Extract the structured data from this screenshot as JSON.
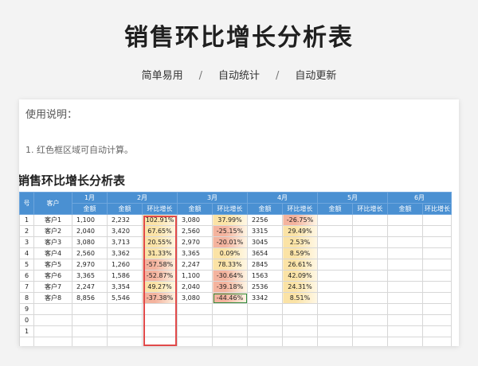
{
  "header": {
    "title": "销售环比增长分析表",
    "features": [
      "简单易用",
      "自动统计",
      "自动更新"
    ],
    "separator": "/"
  },
  "sheet": {
    "usage_label": "使用说明：",
    "note": "1. 红色框区域可自动计算。",
    "title": "销售环比增长分析表",
    "index_header": "号",
    "customer_header": "客户",
    "months": [
      "1月",
      "2月",
      "3月",
      "4月",
      "5月",
      "6月"
    ],
    "sub_amount": "金额",
    "sub_growth": "环比增长",
    "rows": [
      {
        "idx": "1",
        "name": "客户1",
        "m1": "1,100",
        "m2": "2,232",
        "g2": "102.91%",
        "m3": "3,080",
        "g3": "37.99%",
        "m4": "2256",
        "g4": "-26.75%"
      },
      {
        "idx": "2",
        "name": "客户2",
        "m1": "2,040",
        "m2": "3,420",
        "g2": "67.65%",
        "m3": "2,560",
        "g3": "-25.15%",
        "m4": "3315",
        "g4": "29.49%"
      },
      {
        "idx": "3",
        "name": "客户3",
        "m1": "3,080",
        "m2": "3,713",
        "g2": "20.55%",
        "m3": "2,970",
        "g3": "-20.01%",
        "m4": "3045",
        "g4": "2.53%"
      },
      {
        "idx": "4",
        "name": "客户4",
        "m1": "2,560",
        "m2": "3,362",
        "g2": "31.33%",
        "m3": "3,365",
        "g3": "0.09%",
        "m4": "3654",
        "g4": "8.59%"
      },
      {
        "idx": "5",
        "name": "客户5",
        "m1": "2,970",
        "m2": "1,260",
        "g2": "-57.58%",
        "m3": "2,247",
        "g3": "78.33%",
        "m4": "2845",
        "g4": "26.61%"
      },
      {
        "idx": "6",
        "name": "客户6",
        "m1": "3,365",
        "m2": "1,586",
        "g2": "-52.87%",
        "m3": "1,100",
        "g3": "-30.64%",
        "m4": "1563",
        "g4": "42.09%"
      },
      {
        "idx": "7",
        "name": "客户7",
        "m1": "2,247",
        "m2": "3,354",
        "g2": "49.27%",
        "m3": "2,040",
        "g3": "-39.18%",
        "m4": "2536",
        "g4": "24.31%"
      },
      {
        "idx": "8",
        "name": "客户8",
        "m1": "8,856",
        "m2": "5,546",
        "g2": "-37.38%",
        "m3": "3,080",
        "g3": "-44.46%",
        "m4": "3342",
        "g4": "8.51%"
      }
    ],
    "empty_row_indices": [
      "9",
      "0",
      "1",
      ""
    ],
    "colors": {
      "header_blue": "#4a90d2",
      "positive": "#fbe3a6",
      "negative": "#f4b39e",
      "red_box": "#e14a4a",
      "selection": "#2f8a3b"
    }
  }
}
